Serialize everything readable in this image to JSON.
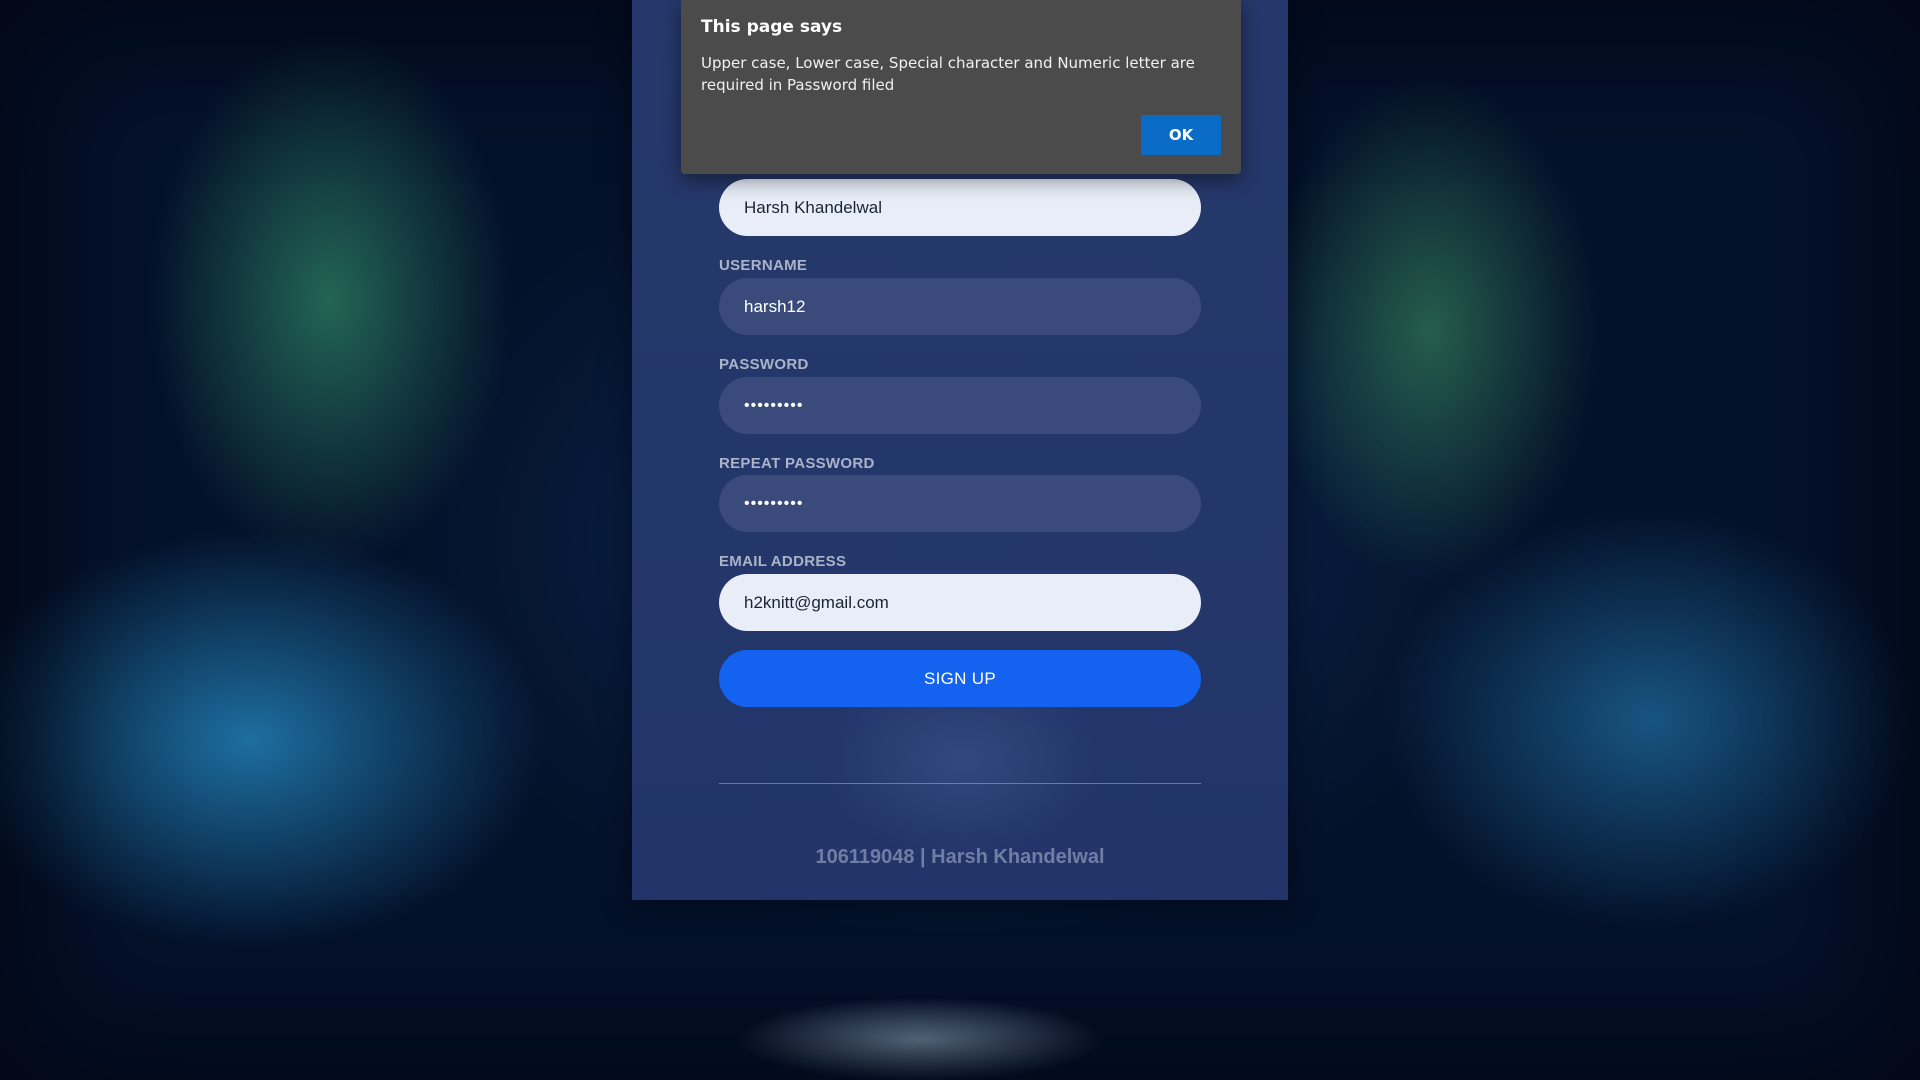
{
  "form": {
    "fields": [
      {
        "label": "",
        "value": "Harsh Khandelwal"
      },
      {
        "label": "USERNAME",
        "value": "harsh12"
      },
      {
        "label": "PASSWORD",
        "value": "•••••••••"
      },
      {
        "label": "REPEAT PASSWORD",
        "value": "•••••••••"
      },
      {
        "label": "EMAIL ADDRESS",
        "value": "h2knitt@gmail.com"
      }
    ],
    "signup_label": "SIGN UP",
    "footer": "106119048 | Harsh Khandelwal"
  },
  "dialog": {
    "title": "This page says",
    "message": "Upper case, Lower case, Special character and Numeric letter are required in Password filed",
    "ok_label": "OK"
  },
  "colors": {
    "panel": "#24376a",
    "button": "#1463f0",
    "dialog": "#4b4b4b",
    "ok_button": "#0b6cc8"
  }
}
